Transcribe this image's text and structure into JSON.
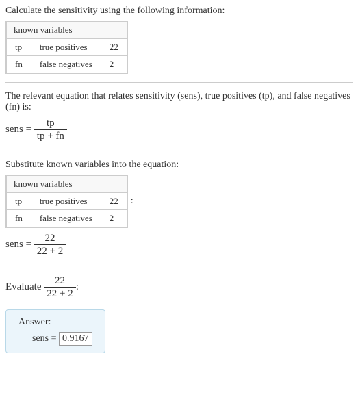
{
  "problem": {
    "prompt": "Calculate the sensitivity using the following information:",
    "known_header": "known variables",
    "rows": [
      {
        "sym": "tp",
        "name": "true positives",
        "val": "22"
      },
      {
        "sym": "fn",
        "name": "false negatives",
        "val": "2"
      }
    ]
  },
  "equation": {
    "preamble": "The relevant equation that relates sensitivity (sens), true positives (tp), and false negatives (fn) is:",
    "lhs": "sens = ",
    "numerator": "tp",
    "denominator": "tp + fn"
  },
  "substitute": {
    "preamble": "Substitute known variables into the equation:",
    "colon": ":",
    "lhs": "sens = ",
    "numerator": "22",
    "denominator": "22 + 2"
  },
  "evaluate": {
    "prefix": "Evaluate ",
    "numerator": "22",
    "denominator": "22 + 2",
    "suffix": ":"
  },
  "answer": {
    "label": "Answer:",
    "lhs": "sens = ",
    "value": "0.9167"
  }
}
